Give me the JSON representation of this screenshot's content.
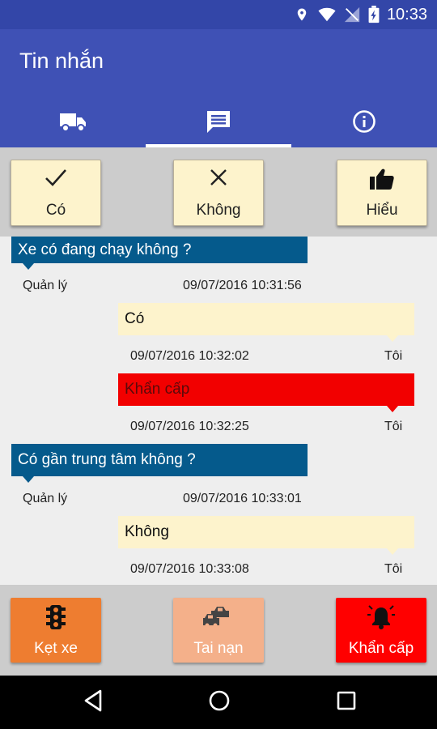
{
  "status_bar": {
    "time": "10:33"
  },
  "app_bar": {
    "title": "Tin nhắn"
  },
  "tabs": [
    {
      "icon": "truck-icon",
      "selected": false
    },
    {
      "icon": "message-icon",
      "selected": true
    },
    {
      "icon": "info-icon",
      "selected": false
    }
  ],
  "quick_replies": [
    {
      "label": "Có",
      "icon": "check-icon"
    },
    {
      "label": "Không",
      "icon": "close-icon"
    },
    {
      "label": "Hiểu",
      "icon": "thumbs-up-icon"
    }
  ],
  "messages": [
    {
      "direction": "incoming",
      "text": "Xe có đang chạy không ?",
      "sender": "Quản lý",
      "time": "09/07/2016 10:31:56"
    },
    {
      "direction": "outgoing",
      "text": "Có",
      "sender": "Tôi",
      "time": "09/07/2016 10:32:02"
    },
    {
      "direction": "outgoing",
      "text": "Khẩn cấp",
      "sender": "Tôi",
      "time": "09/07/2016 10:32:25",
      "urgent": true
    },
    {
      "direction": "incoming",
      "text": "Có gần trung tâm không ?",
      "sender": "Quản lý",
      "time": "09/07/2016 10:33:01"
    },
    {
      "direction": "outgoing",
      "text": "Không",
      "sender": "Tôi",
      "time": "09/07/2016 10:33:08"
    }
  ],
  "actions": [
    {
      "label": "Kẹt xe",
      "icon": "traffic-light-icon",
      "color": "#ee7d30"
    },
    {
      "label": "Tai nạn",
      "icon": "car-crash-icon",
      "color": "#f4b08a"
    },
    {
      "label": "Khẩn cấp",
      "icon": "alarm-bell-icon",
      "color": "#ff0000"
    }
  ],
  "colors": {
    "primary": "#3f51b5",
    "status_bar": "#3346a8",
    "incoming_bubble": "#055a8c",
    "outgoing_bubble": "#fdf3cc",
    "urgent_bubble": "#f20000"
  }
}
